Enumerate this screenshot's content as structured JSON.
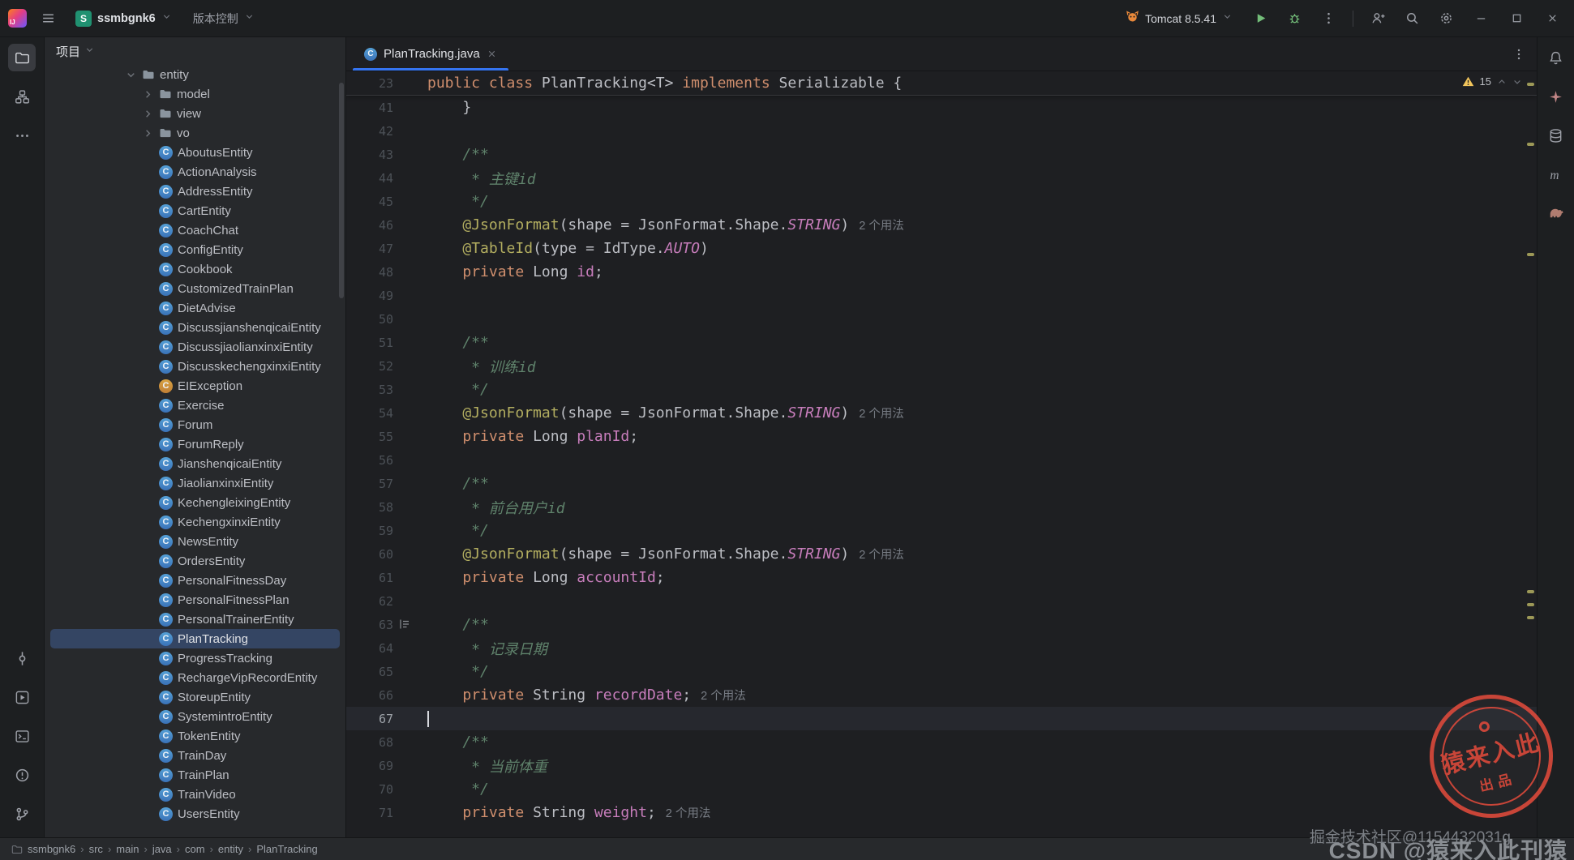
{
  "colors": {
    "accent": "#3574f0",
    "selection": "#344563",
    "keyword": "#cf8e6d",
    "annotation": "#b3ae60",
    "field": "#c77dbb",
    "comment": "#5f826b",
    "warning": "#f2c55c",
    "run_green": "#73bd79",
    "stamp_red": "#e04b3c"
  },
  "titlebar": {
    "logo_text": "IJ",
    "project_badge": "S",
    "project_name": "ssmbgnk6",
    "vcs_label": "版本控制",
    "run_config": "Tomcat 8.5.41"
  },
  "activity_bar_left": {
    "active": "project-folder-icon",
    "top": [
      "project-folder-icon",
      "structure-icon",
      "more-tools-icon"
    ],
    "bottom": [
      "commit-icon",
      "services-icon",
      "terminal-icon",
      "problems-icon",
      "version-control-icon"
    ]
  },
  "activity_bar_right": {
    "top": [
      "notifications-bell-icon",
      "ai-assistant-icon",
      "database-icon",
      "maven-icon",
      "gradle-icon"
    ]
  },
  "project_panel": {
    "header": "项目",
    "class_icon_letter": "C",
    "items": [
      {
        "label": "entity",
        "kind": "folder",
        "level": 0,
        "chevron": "down"
      },
      {
        "label": "model",
        "kind": "folder",
        "level": 1,
        "chevron": "right"
      },
      {
        "label": "view",
        "kind": "folder",
        "level": 1,
        "chevron": "right"
      },
      {
        "label": "vo",
        "kind": "folder",
        "level": 1,
        "chevron": "right"
      },
      {
        "label": "AboutusEntity",
        "kind": "class",
        "level": 1
      },
      {
        "label": "ActionAnalysis",
        "kind": "class",
        "level": 1
      },
      {
        "label": "AddressEntity",
        "kind": "class",
        "level": 1
      },
      {
        "label": "CartEntity",
        "kind": "class",
        "level": 1
      },
      {
        "label": "CoachChat",
        "kind": "class",
        "level": 1
      },
      {
        "label": "ConfigEntity",
        "kind": "class",
        "level": 1
      },
      {
        "label": "Cookbook",
        "kind": "class",
        "level": 1
      },
      {
        "label": "CustomizedTrainPlan",
        "kind": "class",
        "level": 1
      },
      {
        "label": "DietAdvise",
        "kind": "class",
        "level": 1
      },
      {
        "label": "DiscussjianshenqicaiEntity",
        "kind": "class",
        "level": 1
      },
      {
        "label": "DiscussjiaolianxinxiEntity",
        "kind": "class",
        "level": 1
      },
      {
        "label": "DiscusskechengxinxiEntity",
        "kind": "class",
        "level": 1
      },
      {
        "label": "EIException",
        "kind": "exception",
        "level": 1
      },
      {
        "label": "Exercise",
        "kind": "class",
        "level": 1
      },
      {
        "label": "Forum",
        "kind": "class",
        "level": 1
      },
      {
        "label": "ForumReply",
        "kind": "class",
        "level": 1
      },
      {
        "label": "JianshenqicaiEntity",
        "kind": "class",
        "level": 1
      },
      {
        "label": "JiaolianxinxiEntity",
        "kind": "class",
        "level": 1
      },
      {
        "label": "KechengleixingEntity",
        "kind": "class",
        "level": 1
      },
      {
        "label": "KechengxinxiEntity",
        "kind": "class",
        "level": 1
      },
      {
        "label": "NewsEntity",
        "kind": "class",
        "level": 1
      },
      {
        "label": "OrdersEntity",
        "kind": "class",
        "level": 1
      },
      {
        "label": "PersonalFitnessDay",
        "kind": "class",
        "level": 1
      },
      {
        "label": "PersonalFitnessPlan",
        "kind": "class",
        "level": 1
      },
      {
        "label": "PersonalTrainerEntity",
        "kind": "class",
        "level": 1
      },
      {
        "label": "PlanTracking",
        "kind": "class",
        "level": 1,
        "selected": true
      },
      {
        "label": "ProgressTracking",
        "kind": "class",
        "level": 1
      },
      {
        "label": "RechargeVipRecordEntity",
        "kind": "class",
        "level": 1
      },
      {
        "label": "StoreupEntity",
        "kind": "class",
        "level": 1
      },
      {
        "label": "SystemintroEntity",
        "kind": "class",
        "level": 1
      },
      {
        "label": "TokenEntity",
        "kind": "class",
        "level": 1
      },
      {
        "label": "TrainDay",
        "kind": "class",
        "level": 1
      },
      {
        "label": "TrainPlan",
        "kind": "class",
        "level": 1
      },
      {
        "label": "TrainVideo",
        "kind": "class",
        "level": 1
      },
      {
        "label": "UsersEntity",
        "kind": "class",
        "level": 1
      }
    ]
  },
  "editor": {
    "tab_title": "PlanTracking.java",
    "class_icon_letter": "C",
    "inspections_warning_count": "15",
    "sticky_line": {
      "num": 23,
      "segments": [
        [
          "public class ",
          "kw"
        ],
        [
          "PlanTracking<T> ",
          "pln"
        ],
        [
          "implements ",
          "kw"
        ],
        [
          "Serializable {",
          "pln"
        ]
      ]
    },
    "lines": [
      {
        "num": 41,
        "segments": [
          [
            "    }",
            "pln"
          ]
        ]
      },
      {
        "num": 42,
        "segments": []
      },
      {
        "num": 43,
        "segments": [
          [
            "    /**",
            "cmt"
          ]
        ]
      },
      {
        "num": 44,
        "segments": [
          [
            "     * 主键id",
            "cmt"
          ]
        ]
      },
      {
        "num": 45,
        "segments": [
          [
            "     */",
            "cmt"
          ]
        ]
      },
      {
        "num": 46,
        "segments": [
          [
            "    ",
            "pln"
          ],
          [
            "@JsonFormat",
            "ann"
          ],
          [
            "(shape = JsonFormat.Shape.",
            "pln"
          ],
          [
            "STRING",
            "const"
          ],
          [
            ")",
            "pln"
          ]
        ],
        "hint": "2 个用法"
      },
      {
        "num": 47,
        "segments": [
          [
            "    ",
            "pln"
          ],
          [
            "@TableId",
            "ann"
          ],
          [
            "(type = IdType.",
            "pln"
          ],
          [
            "AUTO",
            "const"
          ],
          [
            ")",
            "pln"
          ]
        ]
      },
      {
        "num": 48,
        "segments": [
          [
            "    ",
            "pln"
          ],
          [
            "private ",
            "kw"
          ],
          [
            "Long ",
            "pln"
          ],
          [
            "id",
            "field"
          ],
          [
            ";",
            "pln"
          ]
        ]
      },
      {
        "num": 49,
        "segments": []
      },
      {
        "num": 50,
        "segments": []
      },
      {
        "num": 51,
        "segments": [
          [
            "    /**",
            "cmt"
          ]
        ]
      },
      {
        "num": 52,
        "segments": [
          [
            "     * 训练id",
            "cmt"
          ]
        ]
      },
      {
        "num": 53,
        "segments": [
          [
            "     */",
            "cmt"
          ]
        ]
      },
      {
        "num": 54,
        "segments": [
          [
            "    ",
            "pln"
          ],
          [
            "@JsonFormat",
            "ann"
          ],
          [
            "(shape = JsonFormat.Shape.",
            "pln"
          ],
          [
            "STRING",
            "const"
          ],
          [
            ")",
            "pln"
          ]
        ],
        "hint": "2 个用法"
      },
      {
        "num": 55,
        "segments": [
          [
            "    ",
            "pln"
          ],
          [
            "private ",
            "kw"
          ],
          [
            "Long ",
            "pln"
          ],
          [
            "planId",
            "field"
          ],
          [
            ";",
            "pln"
          ]
        ]
      },
      {
        "num": 56,
        "segments": []
      },
      {
        "num": 57,
        "segments": [
          [
            "    /**",
            "cmt"
          ]
        ]
      },
      {
        "num": 58,
        "segments": [
          [
            "     * 前台用户id",
            "cmt"
          ]
        ]
      },
      {
        "num": 59,
        "segments": [
          [
            "     */",
            "cmt"
          ]
        ]
      },
      {
        "num": 60,
        "segments": [
          [
            "    ",
            "pln"
          ],
          [
            "@JsonFormat",
            "ann"
          ],
          [
            "(shape = JsonFormat.Shape.",
            "pln"
          ],
          [
            "STRING",
            "const"
          ],
          [
            ")",
            "pln"
          ]
        ],
        "hint": "2 个用法"
      },
      {
        "num": 61,
        "segments": [
          [
            "    ",
            "pln"
          ],
          [
            "private ",
            "kw"
          ],
          [
            "Long ",
            "pln"
          ],
          [
            "accountId",
            "field"
          ],
          [
            ";",
            "pln"
          ]
        ]
      },
      {
        "num": 62,
        "segments": []
      },
      {
        "num": 63,
        "segments": [
          [
            "    /**",
            "cmt"
          ]
        ],
        "gutter_icon": true
      },
      {
        "num": 64,
        "segments": [
          [
            "     * 记录日期",
            "cmt"
          ]
        ]
      },
      {
        "num": 65,
        "segments": [
          [
            "     */",
            "cmt"
          ]
        ]
      },
      {
        "num": 66,
        "segments": [
          [
            "    ",
            "pln"
          ],
          [
            "private ",
            "kw"
          ],
          [
            "String ",
            "pln"
          ],
          [
            "recordDate",
            "field"
          ],
          [
            ";",
            "pln"
          ]
        ],
        "hint": "2 个用法"
      },
      {
        "num": 67,
        "segments": [],
        "current": true,
        "cursor": true
      },
      {
        "num": 68,
        "segments": [
          [
            "    /**",
            "cmt"
          ]
        ]
      },
      {
        "num": 69,
        "segments": [
          [
            "     * 当前体重",
            "cmt"
          ]
        ]
      },
      {
        "num": 70,
        "segments": [
          [
            "     */",
            "cmt"
          ]
        ]
      },
      {
        "num": 71,
        "segments": [
          [
            "    ",
            "pln"
          ],
          [
            "private ",
            "kw"
          ],
          [
            "String ",
            "pln"
          ],
          [
            "weight",
            "field"
          ],
          [
            ";",
            "pln"
          ]
        ],
        "hint": "2 个用法"
      }
    ]
  },
  "status_bar": {
    "breadcrumbs": [
      "ssmbgnk6",
      "src",
      "main",
      "java",
      "com",
      "entity",
      "PlanTracking"
    ]
  },
  "watermarks": {
    "stamp_line1": "猿来入此",
    "stamp_line2": "出品",
    "juejin": "掘金技术社区@1154432031g",
    "csdn": "CSDN @猿来入此刊猿"
  }
}
